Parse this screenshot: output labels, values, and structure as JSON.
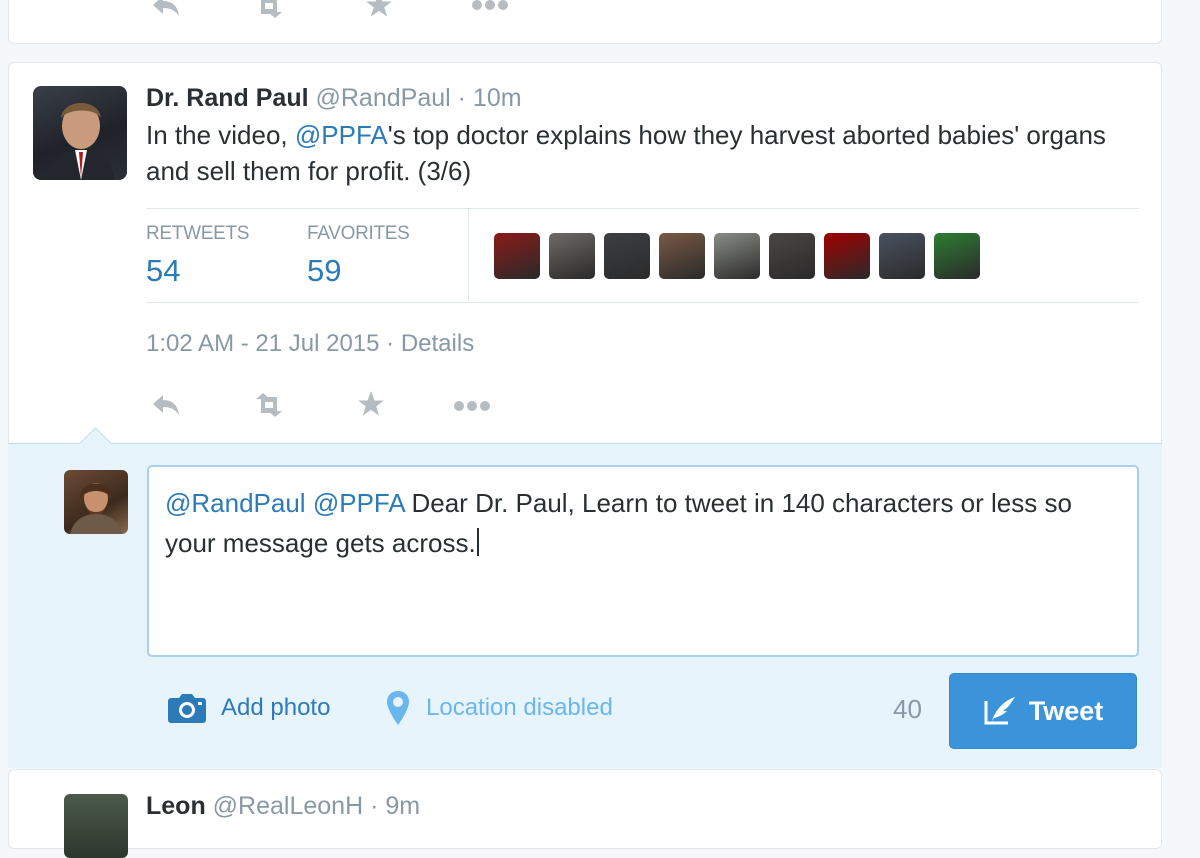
{
  "prev_tweet": {
    "actions": [
      "reply-icon",
      "retweet-icon",
      "favorite-icon",
      "more-icon"
    ]
  },
  "tweet": {
    "name": "Dr. Rand Paul",
    "handle": "@RandPaul",
    "separator": "·",
    "time": "10m",
    "text_mention": "@PPFA",
    "text_before": "In the video, ",
    "text_after": "'s top doctor explains how they harvest aborted babies' organs and sell them for profit. (3/6)",
    "stats": {
      "retweets_label": "RETWEETS",
      "retweets_value": "54",
      "favorites_label": "FAVORITES",
      "favorites_value": "59"
    },
    "favoriter_avatar_colors": [
      "#8b1a1a",
      "#6e6a66",
      "#3c3f44",
      "#7a5a45",
      "#8a8d86",
      "#4b4644",
      "#a10000",
      "#4a5260",
      "#2e7d32"
    ],
    "timestamp": "1:02 AM - 21 Jul 2015",
    "details_sep": "·",
    "details_label": "Details"
  },
  "reply": {
    "mention1": "@RandPaul",
    "mention2": "@PPFA",
    "text": " Dear Dr. Paul, Learn to tweet in 140 characters or less so your message gets across.",
    "add_photo_label": "Add photo",
    "location_label": "Location disabled",
    "char_counter": "40",
    "tweet_button_label": "Tweet"
  },
  "next_tweet": {
    "name": "Leon",
    "handle": "@RealLeonH",
    "separator": "·",
    "time": "9m"
  },
  "colors": {
    "link": "#2b7bb9",
    "tweet_button": "#3b94d9",
    "reply_bg": "#e8f4fb",
    "muted": "#8899a6"
  }
}
